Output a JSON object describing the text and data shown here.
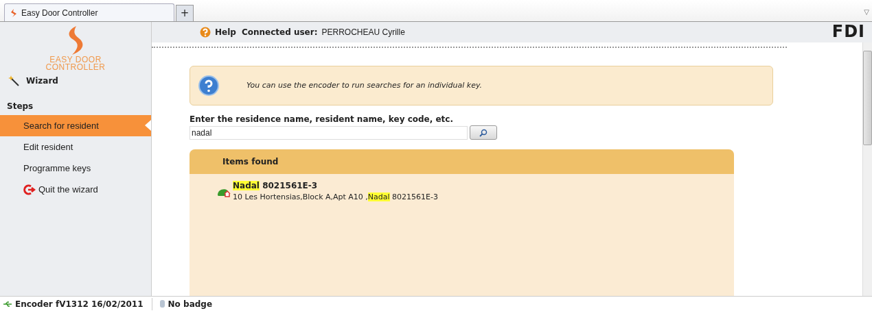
{
  "browser": {
    "tab_title": "Easy Door Controller",
    "new_tab": "+",
    "menu_glyph": "▽"
  },
  "sidebar": {
    "logo_text": [
      "EASY DOOR",
      "CONTROLLER"
    ],
    "wizard": "Wizard",
    "steps_heading": "Steps",
    "items": [
      {
        "label": "Search for resident",
        "selected": true,
        "kind": "step"
      },
      {
        "label": "Edit resident",
        "selected": false,
        "kind": "step"
      },
      {
        "label": "Programme keys",
        "selected": false,
        "kind": "step"
      },
      {
        "label": "Quit the wizard",
        "selected": false,
        "kind": "quit"
      }
    ]
  },
  "header": {
    "help": "Help",
    "user_label": "Connected user:",
    "user_name": "PERROCHEAU Cyrille",
    "brand": "FDI"
  },
  "info": "You can use the encoder to run searches for an individual key.",
  "search": {
    "label": "Enter the residence name, resident name, key code, etc.",
    "value": "nadal"
  },
  "results": {
    "heading": "Items found",
    "items": [
      {
        "title": [
          {
            "text": "Nadal",
            "highlighted": true
          },
          {
            "text": " 8021561E-3",
            "highlighted": false
          }
        ],
        "detail": [
          {
            "text": "10 Les Hortensias,Block A,Apt A10 ,",
            "highlighted": false
          },
          {
            "text": "Nadal",
            "highlighted": true
          },
          {
            "text": " 8021561E-3",
            "highlighted": false
          }
        ]
      }
    ]
  },
  "status_bar": {
    "encoder": "Encoder fV1312 16/02/2011",
    "badge": "No badge"
  }
}
